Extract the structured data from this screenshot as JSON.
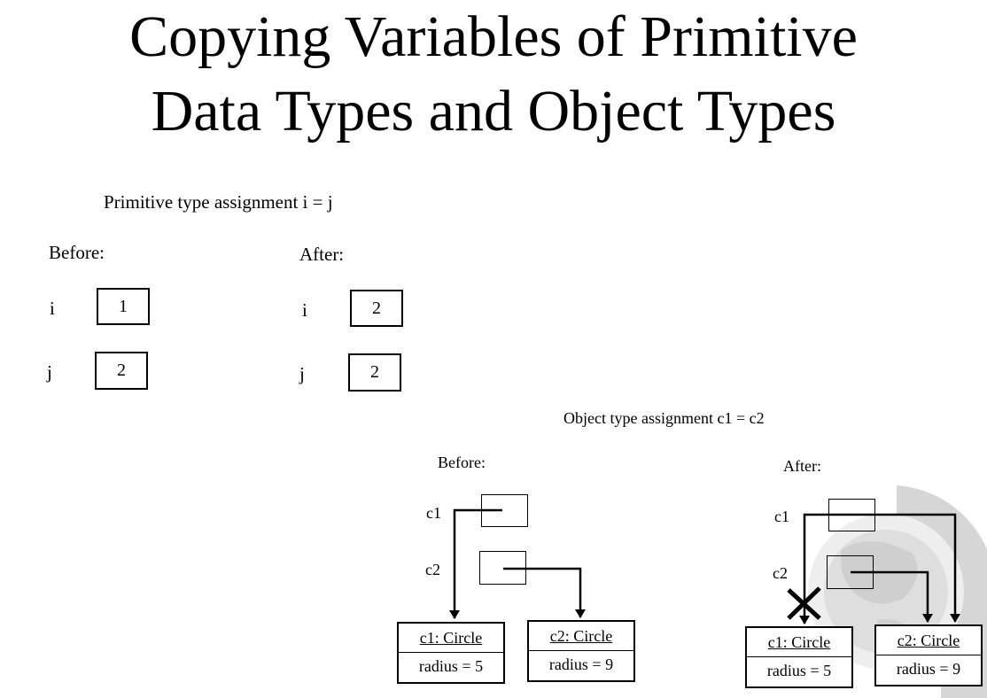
{
  "title": {
    "line1": "Copying Variables of Primitive",
    "line2": "Data Types and Object Types"
  },
  "primitive": {
    "heading": "Primitive type assignment  i = j",
    "before": {
      "label": "Before:",
      "i_label": "i",
      "i_value": "1",
      "j_label": "j",
      "j_value": "2"
    },
    "after": {
      "label": "After:",
      "i_label": "i",
      "i_value": "2",
      "j_label": "j",
      "j_value": "2"
    }
  },
  "object": {
    "heading": "Object type assignment c1 = c2",
    "before": {
      "label": "Before:",
      "c1_label": "c1",
      "c2_label": "c2",
      "obj1_name": "c1: Circle",
      "obj1_field": "radius = 5",
      "obj2_name": "c2: Circle",
      "obj2_field": "radius = 9"
    },
    "after": {
      "label": "After:",
      "c1_label": "c1",
      "c2_label": "c2",
      "obj1_name": "c1: Circle",
      "obj1_field": "radius = 5",
      "obj2_name": "c2: Circle",
      "obj2_field": "radius = 9"
    }
  }
}
